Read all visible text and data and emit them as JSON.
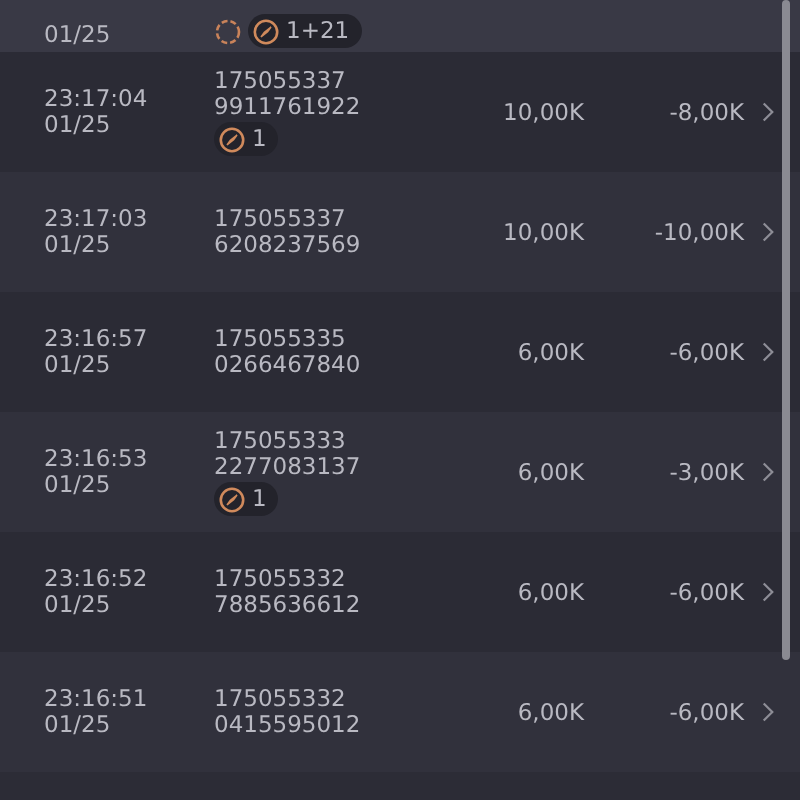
{
  "rows": [
    {
      "date": "01/25",
      "badges": [
        {
          "kind": "spinner"
        },
        {
          "kind": "compass",
          "count": "1+21"
        }
      ]
    },
    {
      "time": "23:17:04",
      "date": "01/25",
      "id_line_1": "175055337",
      "id_line_2": "9911761922",
      "amount": "10,00K",
      "change": "-8,00K",
      "badges": [
        {
          "kind": "compass",
          "count": "1"
        }
      ]
    },
    {
      "time": "23:17:03",
      "date": "01/25",
      "id_line_1": "175055337",
      "id_line_2": "6208237569",
      "amount": "10,00K",
      "change": "-10,00K"
    },
    {
      "time": "23:16:57",
      "date": "01/25",
      "id_line_1": "175055335",
      "id_line_2": "0266467840",
      "amount": "6,00K",
      "change": "-6,00K"
    },
    {
      "time": "23:16:53",
      "date": "01/25",
      "id_line_1": "175055333",
      "id_line_2": "2277083137",
      "amount": "6,00K",
      "change": "-3,00K",
      "badges": [
        {
          "kind": "compass",
          "count": "1"
        }
      ]
    },
    {
      "time": "23:16:52",
      "date": "01/25",
      "id_line_1": "175055332",
      "id_line_2": "7885636612",
      "amount": "6,00K",
      "change": "-6,00K"
    },
    {
      "time": "23:16:51",
      "date": "01/25",
      "id_line_1": "175055332",
      "id_line_2": "0415595012",
      "amount": "6,00K",
      "change": "-6,00K"
    }
  ]
}
